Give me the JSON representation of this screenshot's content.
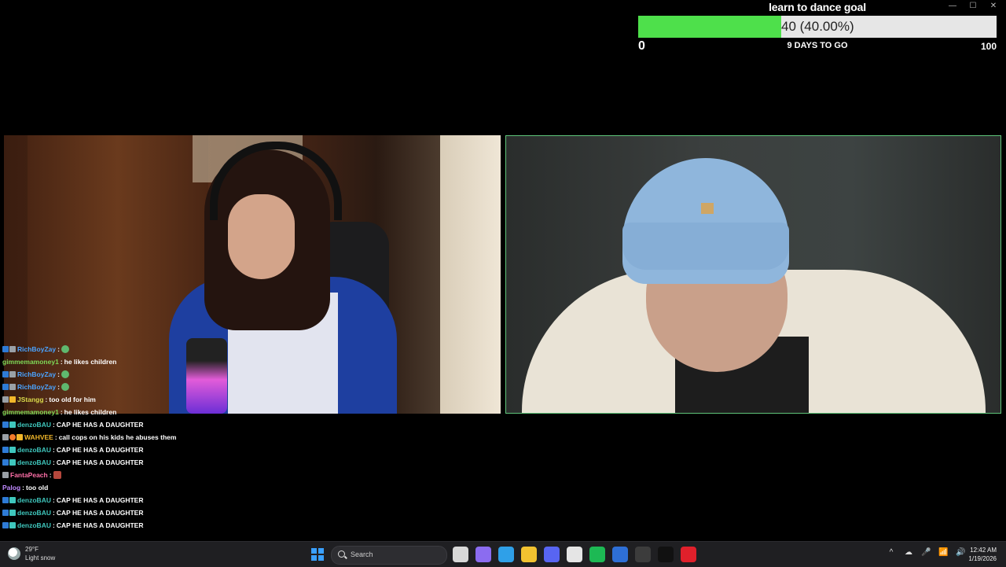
{
  "window": {
    "minimize": "—",
    "maximize": "☐",
    "close": "✕"
  },
  "goal": {
    "title": "learn to dance goal",
    "value_text": "40 (40.00%)",
    "progress_fraction": 0.4,
    "min_label": "0",
    "days_label": "9 DAYS TO GO",
    "max_label": "100",
    "fill_color": "#4ee04b",
    "bar_color": "#e6e6e6"
  },
  "chat": {
    "messages": [
      {
        "user": "RichBoyZay",
        "color": "#4aa3ff",
        "badges": [
          "b-prime",
          "b-mod"
        ],
        "text": "",
        "emote": "green"
      },
      {
        "user": "gimmemamoney1",
        "color": "#7ed957",
        "badges": [],
        "text": "he likes children",
        "emote": ""
      },
      {
        "user": "RichBoyZay",
        "color": "#4aa3ff",
        "badges": [
          "b-prime",
          "b-mod"
        ],
        "text": "",
        "emote": "green"
      },
      {
        "user": "RichBoyZay",
        "color": "#4aa3ff",
        "badges": [
          "b-prime",
          "b-mod"
        ],
        "text": "",
        "emote": "green"
      },
      {
        "user": "JStangg",
        "color": "#d9d94a",
        "badges": [
          "b-mod",
          "b-gold"
        ],
        "text": "too old for him",
        "emote": ""
      },
      {
        "user": "gimmemamoney1",
        "color": "#7ed957",
        "badges": [],
        "text": "he likes children",
        "emote": ""
      },
      {
        "user": "denzoBAU",
        "color": "#3fc7bd",
        "badges": [
          "b-prime",
          "b-sub"
        ],
        "text": "CAP HE HAS A DAUGHTER",
        "emote": ""
      },
      {
        "user": "WAHVEE",
        "color": "#f2b72a",
        "badges": [
          "b-mod",
          "b-orange",
          "b-gold"
        ],
        "text": "call cops on his kids he abuses them",
        "emote": ""
      },
      {
        "user": "denzoBAU",
        "color": "#3fc7bd",
        "badges": [
          "b-prime",
          "b-sub"
        ],
        "text": "CAP HE HAS A DAUGHTER",
        "emote": ""
      },
      {
        "user": "denzoBAU",
        "color": "#3fc7bd",
        "badges": [
          "b-prime",
          "b-sub"
        ],
        "text": "CAP HE HAS A DAUGHTER",
        "emote": ""
      },
      {
        "user": "FantaPeach",
        "color": "#ff6fa8",
        "badges": [
          "b-mod"
        ],
        "text": "",
        "emote": "red"
      },
      {
        "user": "Palog",
        "color": "#c08aff",
        "badges": [],
        "text": "too old",
        "emote": ""
      },
      {
        "user": "denzoBAU",
        "color": "#3fc7bd",
        "badges": [
          "b-prime",
          "b-sub"
        ],
        "text": "CAP HE HAS A DAUGHTER",
        "emote": ""
      },
      {
        "user": "denzoBAU",
        "color": "#3fc7bd",
        "badges": [
          "b-prime",
          "b-sub"
        ],
        "text": "CAP HE HAS A DAUGHTER",
        "emote": ""
      },
      {
        "user": "denzoBAU",
        "color": "#3fc7bd",
        "badges": [
          "b-prime",
          "b-sub"
        ],
        "text": "CAP HE HAS A DAUGHTER",
        "emote": ""
      }
    ],
    "separator": ":"
  },
  "taskbar": {
    "weather_temp": "29°F",
    "weather_desc": "Light snow",
    "search_label": "Search",
    "apps": [
      {
        "name": "file-icon",
        "color": "#d8d8d8"
      },
      {
        "name": "copilot-icon",
        "color": "#8b6cf0"
      },
      {
        "name": "edge-icon",
        "color": "#2fa0e8"
      },
      {
        "name": "folder-icon",
        "color": "#f2c230"
      },
      {
        "name": "discord-icon",
        "color": "#5865f2"
      },
      {
        "name": "store-icon",
        "color": "#e5e5e5"
      },
      {
        "name": "spotify-icon",
        "color": "#1db954"
      },
      {
        "name": "mail-icon",
        "color": "#2e6fd6"
      },
      {
        "name": "obs-icon",
        "color": "#3c3c3c"
      },
      {
        "name": "tiktok-icon",
        "color": "#111111"
      },
      {
        "name": "opera-icon",
        "color": "#e0202b"
      }
    ],
    "tray": [
      "^",
      "☁",
      "🎤",
      "📶",
      "🔊"
    ],
    "time": "12:42 AM",
    "date": "1/19/2026"
  }
}
